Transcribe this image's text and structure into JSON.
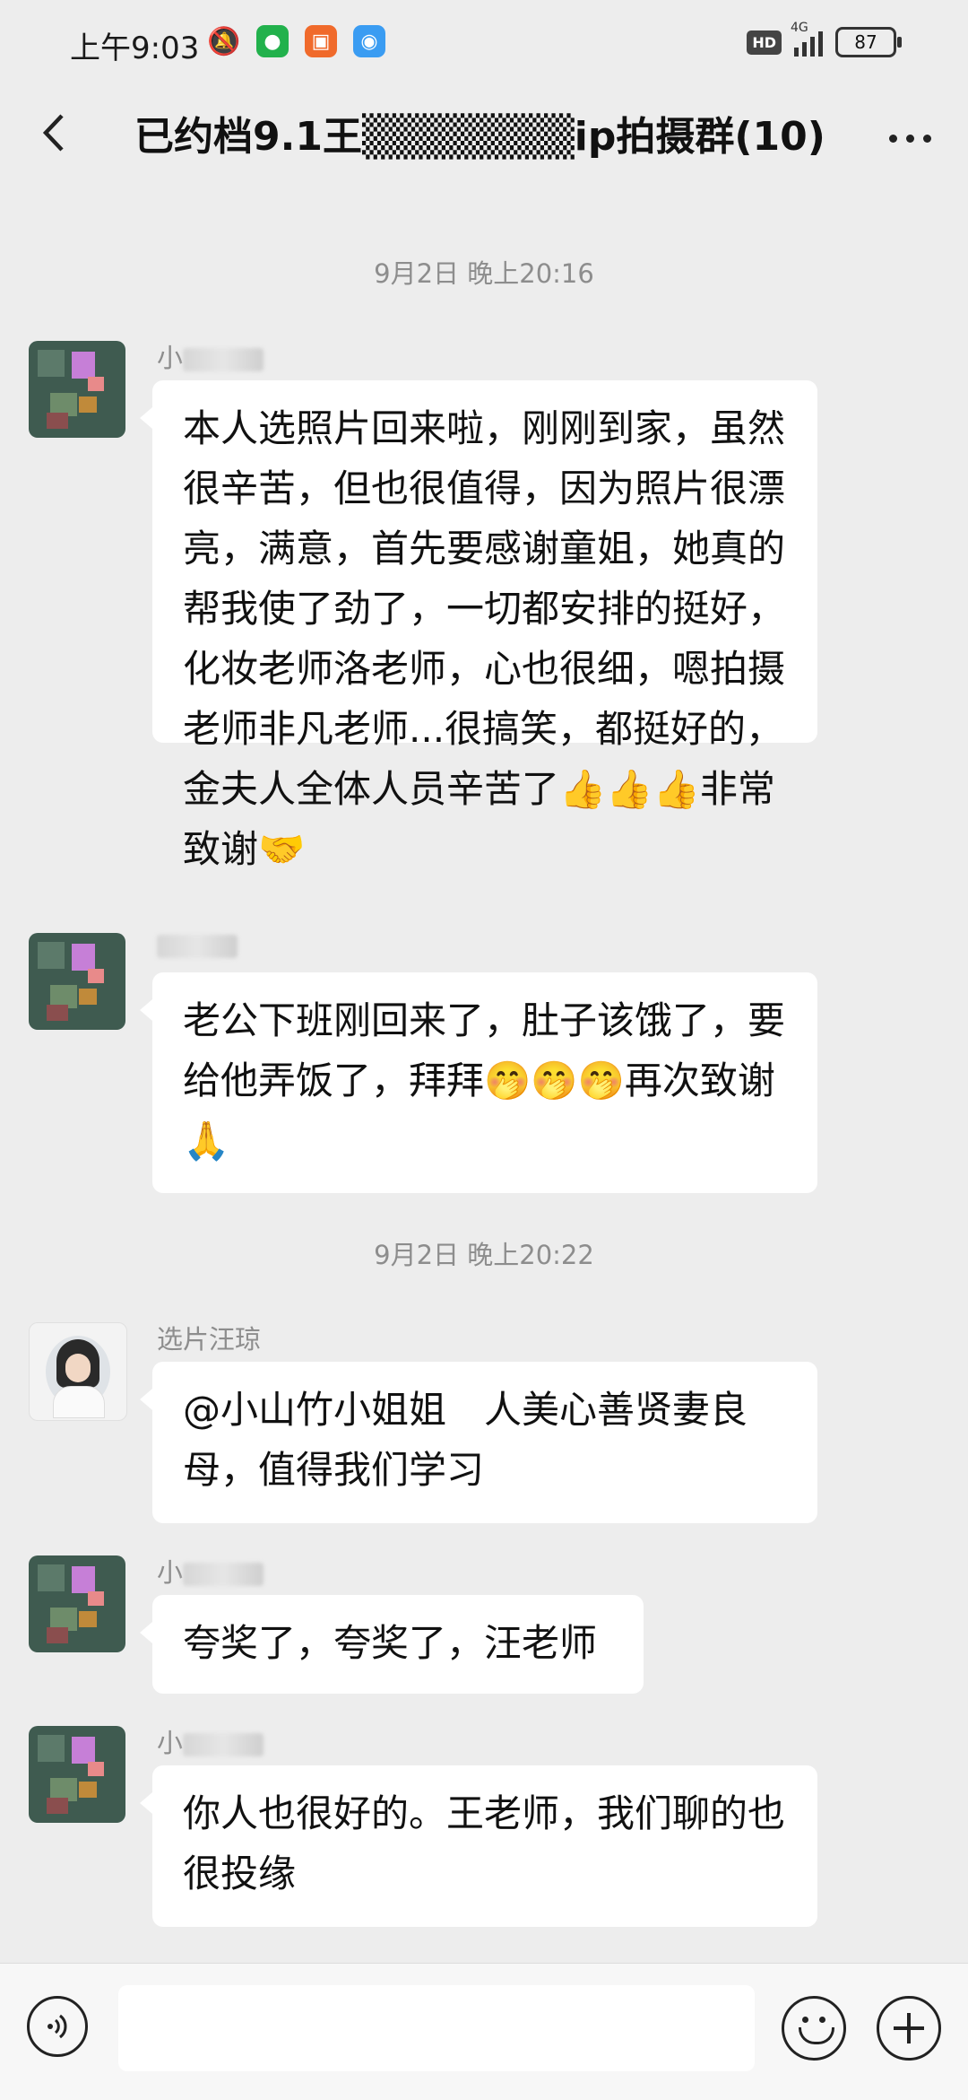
{
  "status_bar": {
    "time": "上午9:03",
    "hd": "HD",
    "network": "4G",
    "battery": "87"
  },
  "navbar": {
    "title": "已约档9.1王▒▒▒▒▒▒▒ip拍摄群(10)"
  },
  "chat": {
    "timestamps": [
      "9月2日 晚上20:16",
      "9月2日 晚上20:22"
    ],
    "messages": [
      {
        "sender": "小",
        "text": "本人选照片回来啦，刚刚到家，虽然很辛苦，但也很值得，因为照片很漂亮，满意，首先要感谢童姐，她真的帮我使了劲了，一切都安排的挺好，化妆老师洛老师，心也很细，嗯拍摄老师非凡老师...很搞笑，都挺好的，金夫人全体人员辛苦了👍👍👍非常致谢🤝"
      },
      {
        "sender": "",
        "text": "老公下班刚回来了，肚子该饿了，要给他弄饭了，拜拜🤭🤭🤭再次致谢🙏"
      },
      {
        "sender": "选片汪琼",
        "text": "@小山竹小姐姐　人美心善贤妻良母，值得我们学习"
      },
      {
        "sender": "小",
        "text": "夸奖了，夸奖了，汪老师"
      },
      {
        "sender": "小",
        "text": "你人也很好的。王老师，我们聊的也很投缘"
      }
    ]
  },
  "colors": {
    "background": "#ededed",
    "bubble": "#ffffff",
    "timestamp": "#8d8d8d"
  },
  "icons": [
    "back-icon",
    "more-icon",
    "voice-icon",
    "emoji-icon",
    "plus-icon"
  ]
}
